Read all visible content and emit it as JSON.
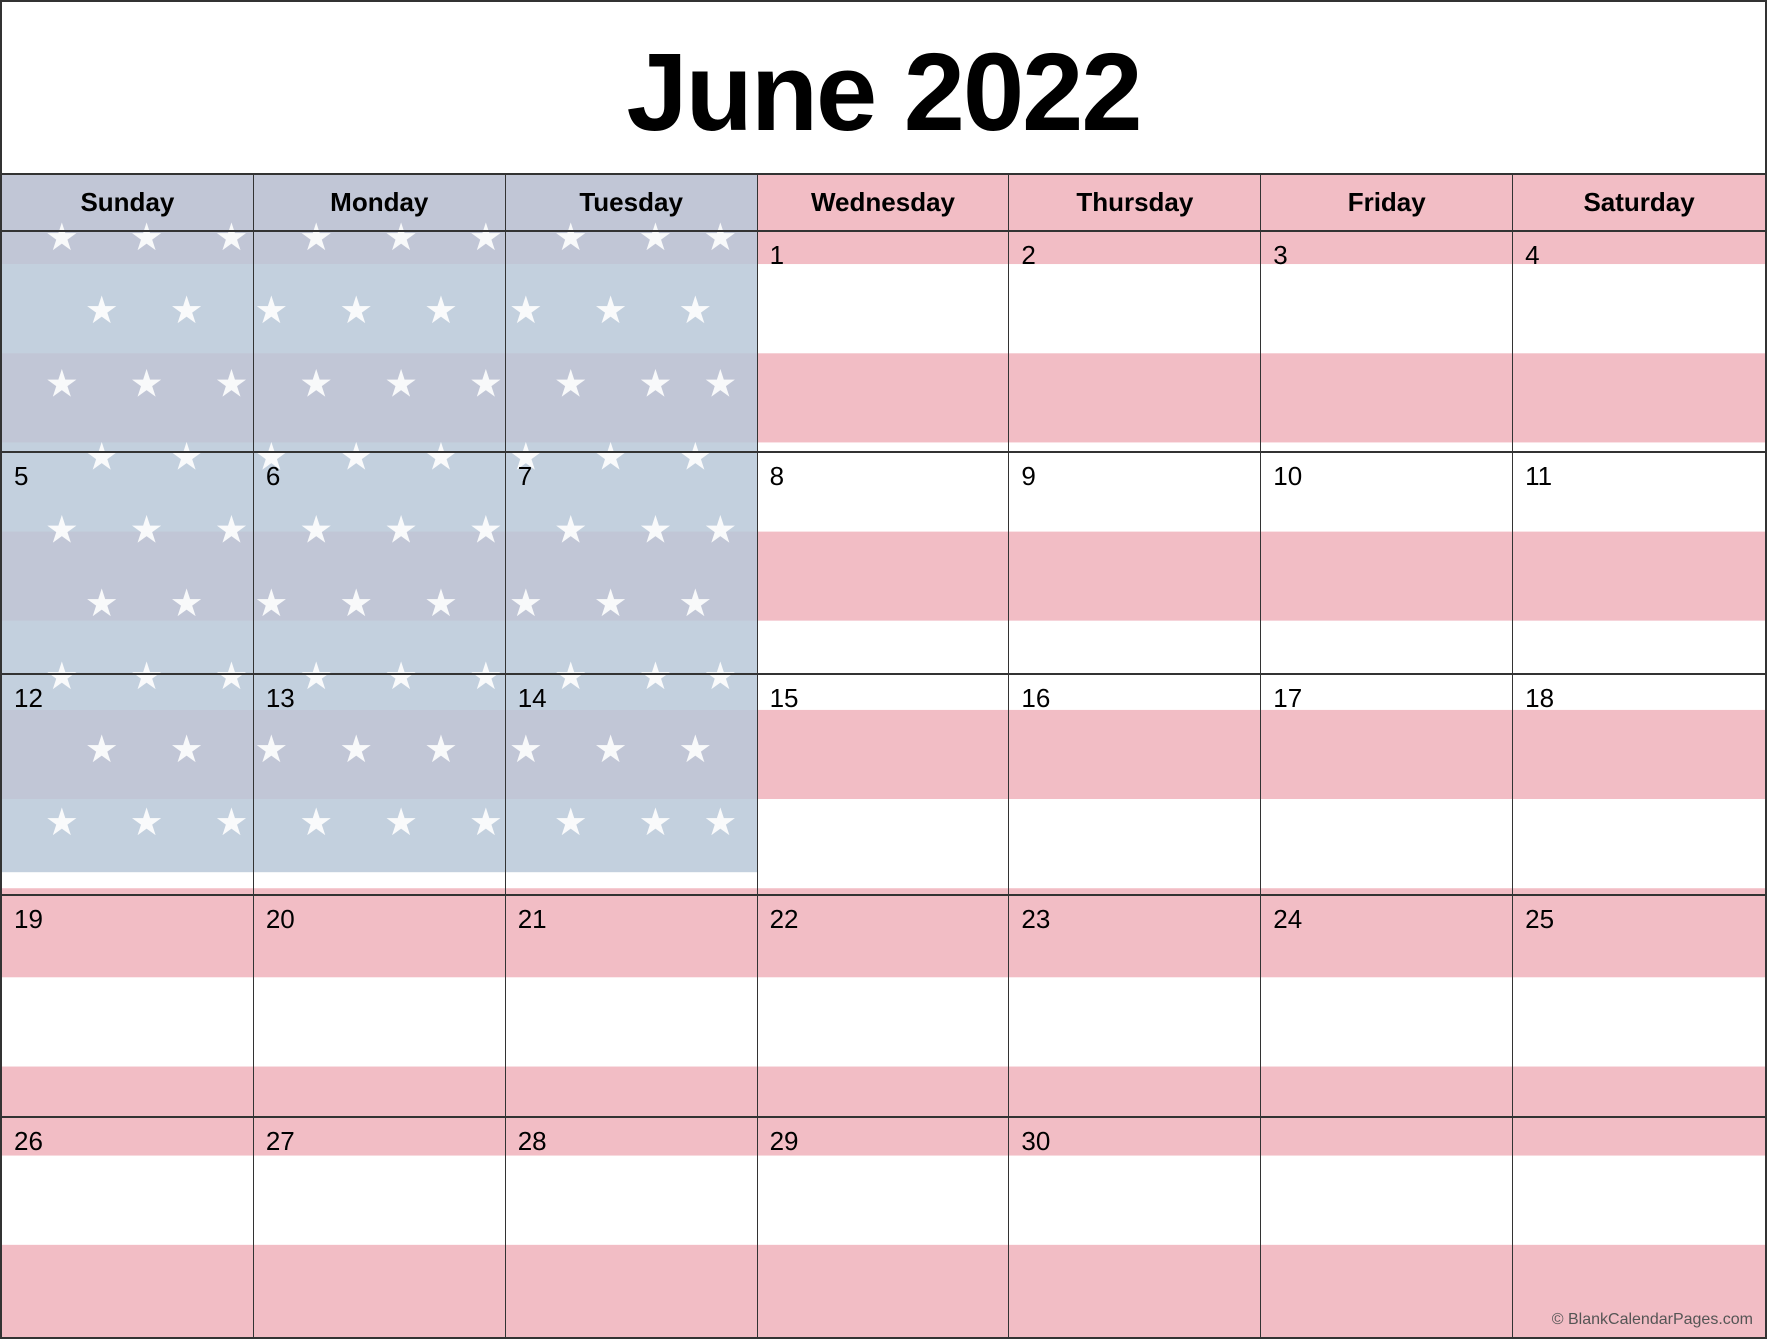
{
  "title": "June 2022",
  "days_of_week": [
    "Sunday",
    "Monday",
    "Tuesday",
    "Wednesday",
    "Thursday",
    "Friday",
    "Saturday"
  ],
  "weeks": [
    [
      {
        "day": "",
        "empty": true,
        "stars": true
      },
      {
        "day": "",
        "empty": true,
        "stars": true
      },
      {
        "day": "",
        "empty": true,
        "stars": true
      },
      {
        "day": "1",
        "empty": false
      },
      {
        "day": "2",
        "empty": false
      },
      {
        "day": "3",
        "empty": false
      },
      {
        "day": "4",
        "empty": false
      }
    ],
    [
      {
        "day": "5",
        "empty": false,
        "stars": true
      },
      {
        "day": "6",
        "empty": false,
        "stars": true
      },
      {
        "day": "7",
        "empty": false,
        "stars": true
      },
      {
        "day": "8",
        "empty": false
      },
      {
        "day": "9",
        "empty": false
      },
      {
        "day": "10",
        "empty": false
      },
      {
        "day": "11",
        "empty": false
      }
    ],
    [
      {
        "day": "12",
        "empty": false,
        "stars": true
      },
      {
        "day": "13",
        "empty": false,
        "stars": true
      },
      {
        "day": "14",
        "empty": false,
        "stars": true
      },
      {
        "day": "15",
        "empty": false
      },
      {
        "day": "16",
        "empty": false
      },
      {
        "day": "17",
        "empty": false
      },
      {
        "day": "18",
        "empty": false
      }
    ],
    [
      {
        "day": "19",
        "empty": false
      },
      {
        "day": "20",
        "empty": false
      },
      {
        "day": "21",
        "empty": false
      },
      {
        "day": "22",
        "empty": false
      },
      {
        "day": "23",
        "empty": false
      },
      {
        "day": "24",
        "empty": false
      },
      {
        "day": "25",
        "empty": false
      }
    ],
    [
      {
        "day": "26",
        "empty": false
      },
      {
        "day": "27",
        "empty": false
      },
      {
        "day": "28",
        "empty": false
      },
      {
        "day": "29",
        "empty": false
      },
      {
        "day": "30",
        "empty": false
      },
      {
        "day": "",
        "empty": true
      },
      {
        "day": "",
        "empty": true
      }
    ]
  ],
  "watermark": "© BlankCalendarPages.com",
  "colors": {
    "stripe_red": "#f2bdc5",
    "stripe_white": "#ffffff",
    "canton_blue": "#b8c8d8",
    "star_color": "#ffffff",
    "border": "#333333",
    "title_color": "#000000"
  }
}
